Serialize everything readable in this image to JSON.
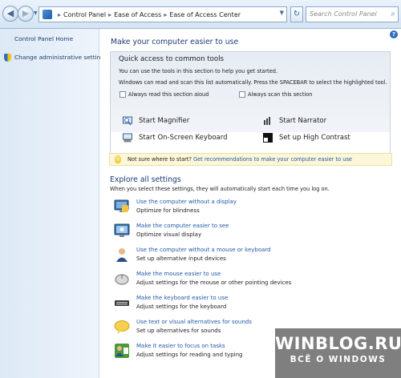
{
  "address_bar": {
    "breadcrumbs": [
      "Control Panel",
      "Ease of Access",
      "Ease of Access Center"
    ],
    "search_placeholder": "Search Control Panel"
  },
  "sidebar": {
    "links": [
      "Control Panel Home",
      "Change administrative settings"
    ]
  },
  "main": {
    "title": "Make your computer easier to use",
    "quick_access": {
      "title": "Quick access to common tools",
      "line1": "You can use the tools in this section to help you get started.",
      "line2": "Windows can read and scan this list automatically.  Press the SPACEBAR to select the highlighted tool.",
      "checkbox_read": "Always read this section aloud",
      "checkbox_scan": "Always scan this section",
      "tools": [
        {
          "label": "Start Magnifier",
          "icon": "magnifier-icon"
        },
        {
          "label": "Start Narrator",
          "icon": "narrator-icon"
        },
        {
          "label": "Start On-Screen Keyboard",
          "icon": "keyboard-icon"
        },
        {
          "label": "Set up High Contrast",
          "icon": "contrast-icon"
        }
      ]
    },
    "tip": {
      "prefix": "Not sure where to start?",
      "link": "Get recommendations to make your computer easier to use"
    },
    "explore": {
      "title": "Explore all settings",
      "subtitle": "When you select these settings, they will automatically start each time you log on.",
      "settings": [
        {
          "link": "Use the computer without a display",
          "desc": "Optimize for blindness",
          "icon": "display-icon"
        },
        {
          "link": "Make the computer easier to see",
          "desc": "Optimize visual display",
          "icon": "monitor-icon"
        },
        {
          "link": "Use the computer without a mouse or keyboard",
          "desc": "Set up alternative input devices",
          "icon": "user-icon"
        },
        {
          "link": "Make the mouse easier to use",
          "desc": "Adjust settings for the mouse or other pointing devices",
          "icon": "mouse-icon"
        },
        {
          "link": "Make the keyboard easier to use",
          "desc": "Adjust settings for the keyboard",
          "icon": "keyboard-icon"
        },
        {
          "link": "Use text or visual alternatives for sounds",
          "desc": "Set up alternatives for sounds",
          "icon": "speech-bubble-icon"
        },
        {
          "link": "Make it easier to focus on tasks",
          "desc": "Adjust settings for reading and typing",
          "icon": "tasks-icon"
        }
      ]
    }
  },
  "watermark": {
    "line1": "WINBLOG.RU",
    "line2": "ВСЁ О WINDOWS"
  }
}
